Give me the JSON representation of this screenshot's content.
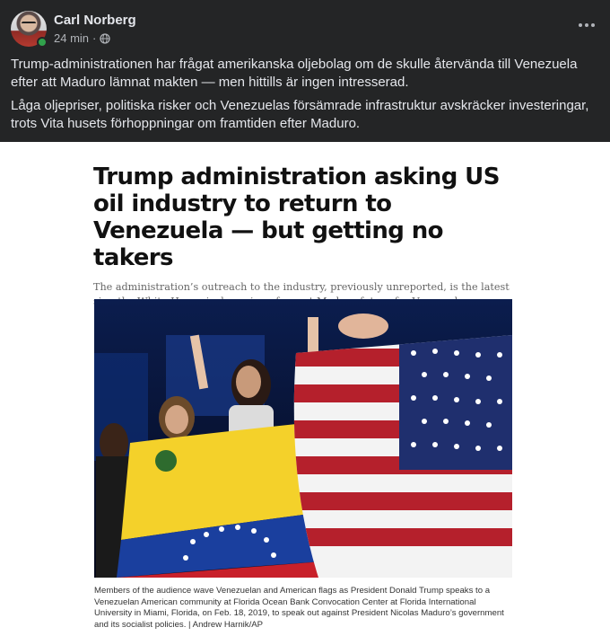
{
  "post": {
    "author": "Carl Norberg",
    "time": "24 min",
    "privacy_icon": "globe-icon",
    "paragraphs": [
      "Trump-administrationen har frågat amerikanska oljebolag om de skulle återvända till Venezuela efter att Maduro lämnat makten — men hittills är ingen intresserad.",
      "Låga oljepriser, politiska risker och Venezuelas försämrade infrastruktur avskräcker investeringar, trots Vita husets förhoppningar om framtiden efter Maduro."
    ]
  },
  "article": {
    "headline": "Trump administration asking US oil industry to return to Venezuela — but getting no takers",
    "deck": "The administration’s outreach to the industry, previously unreported, is the latest sign the White House is dreaming of a post-Maduro future for Venezuela.",
    "caption": "Members of the audience wave Venezuelan and American flags as President Donald Trump speaks to a Venezuelan American community at Florida Ocean Bank Convocation Center at Florida International University in Miami, Florida, on Feb. 18, 2019, to speak out against President Nicolas Maduro’s government and its socialist policies. | Andrew Harnik/AP"
  },
  "colors": {
    "background": "#242526",
    "text_primary": "#e4e6eb",
    "text_secondary": "#b0b3b8",
    "online": "#31a24c"
  }
}
